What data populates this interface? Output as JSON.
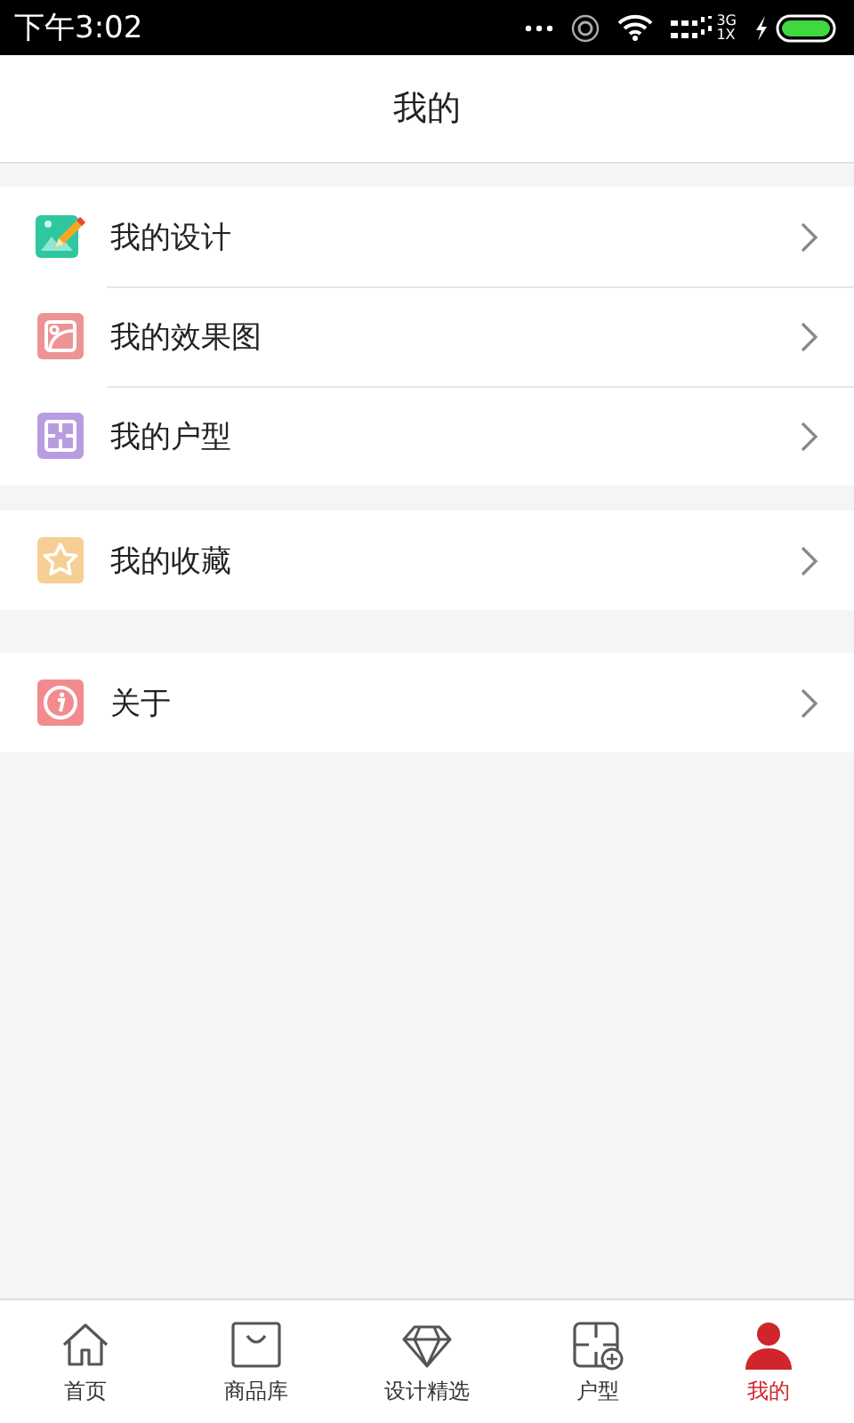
{
  "status_bar": {
    "time": "下午3:02",
    "network_top": "3G",
    "network_bottom": "1X"
  },
  "header": {
    "title": "我的"
  },
  "groups": [
    [
      {
        "label": "我的设计",
        "color": "#2fc7a0"
      },
      {
        "label": "我的效果图",
        "color": "#ec9393"
      },
      {
        "label": "我的户型",
        "color": "#b89ce2"
      }
    ],
    [
      {
        "label": "我的收藏",
        "color": "#f6cf95"
      }
    ],
    [
      {
        "label": "关于",
        "color": "#f28b8f"
      }
    ]
  ],
  "tabs": [
    {
      "label": "首页",
      "selected": false
    },
    {
      "label": "商品库",
      "selected": false
    },
    {
      "label": "设计精选",
      "selected": false
    },
    {
      "label": "户型",
      "selected": false
    },
    {
      "label": "我的",
      "selected": true
    }
  ]
}
